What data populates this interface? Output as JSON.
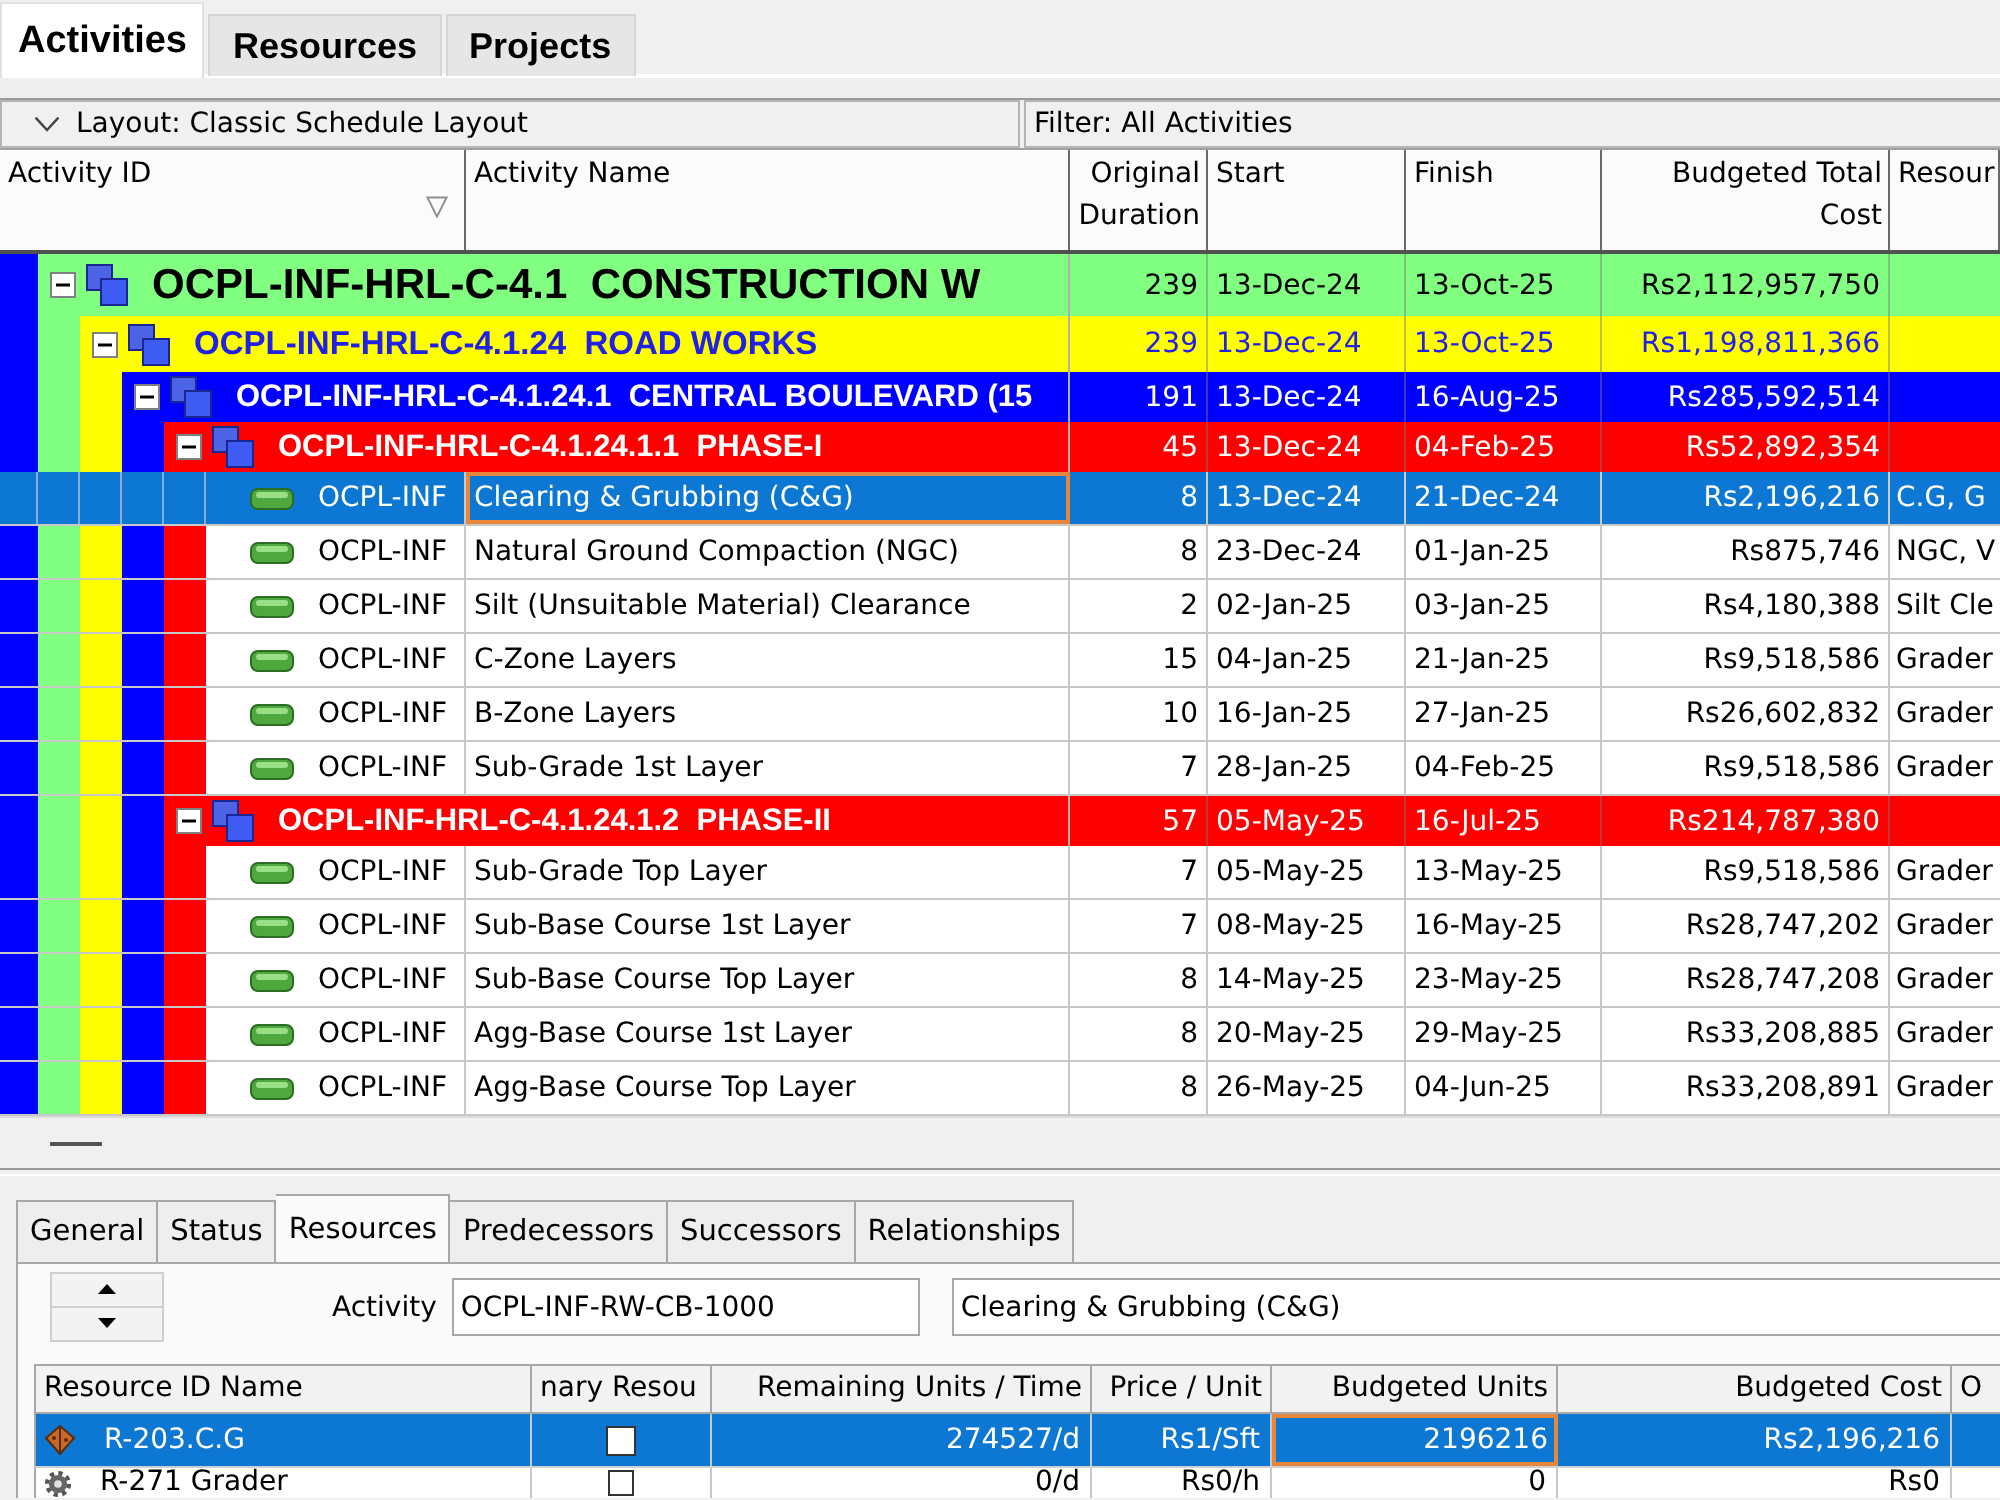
{
  "view_tabs": [
    {
      "label": "Activities",
      "selected": true
    },
    {
      "label": "Resources",
      "selected": false
    },
    {
      "label": "Projects",
      "selected": false
    }
  ],
  "layout_bar": {
    "layout": "Layout: Classic Schedule Layout",
    "filter": "Filter: All Activities"
  },
  "activities_table": {
    "columns": [
      "Activity ID",
      "Activity Name",
      "Original Duration",
      "Start",
      "Finish",
      "Budgeted Total Cost",
      "Resour"
    ],
    "rows": [
      {
        "kind": "wbs",
        "label": "OCPL-INF-HRL-C-4.1  CONSTRUCTION W",
        "expanded": true,
        "selected": false,
        "original_duration": "239",
        "start": "13-Dec-24",
        "finish": "13-Oct-25",
        "budgeted_total_cost": "Rs2,112,957,750",
        "children": [
          {
            "kind": "wbs",
            "label": "OCPL-INF-HRL-C-4.1.24  ROAD WORKS",
            "expanded": true,
            "selected": false,
            "original_duration": "239",
            "start": "13-Dec-24",
            "finish": "13-Oct-25",
            "budgeted_total_cost": "Rs1,198,811,366",
            "children": [
              {
                "kind": "wbs",
                "label": "OCPL-INF-HRL-C-4.1.24.1  CENTRAL BOULEVARD (15",
                "expanded": true,
                "selected": false,
                "original_duration": "191",
                "start": "13-Dec-24",
                "finish": "16-Aug-25",
                "budgeted_total_cost": "Rs285,592,514",
                "children": [
                  {
                    "kind": "wbs",
                    "label": "OCPL-INF-HRL-C-4.1.24.1.1  PHASE-I",
                    "expanded": true,
                    "selected": false,
                    "original_duration": "45",
                    "start": "13-Dec-24",
                    "finish": "04-Feb-25",
                    "budgeted_total_cost": "Rs52,892,354",
                    "children": [
                      {
                        "kind": "activity",
                        "activity_id": "OCPL-INF",
                        "activity_name": "Clearing & Grubbing (C&G)",
                        "original_duration": "8",
                        "start": "13-Dec-24",
                        "finish": "21-Dec-24",
                        "budgeted_total_cost": "Rs2,196,216",
                        "resources": "C.G, G",
                        "selected": true
                      },
                      {
                        "kind": "activity",
                        "activity_id": "OCPL-INF",
                        "activity_name": "Natural Ground Compaction (NGC)",
                        "original_duration": "8",
                        "start": "23-Dec-24",
                        "finish": "01-Jan-25",
                        "budgeted_total_cost": "Rs875,746",
                        "resources": "NGC, V",
                        "selected": false
                      },
                      {
                        "kind": "activity",
                        "activity_id": "OCPL-INF",
                        "activity_name": "Silt (Unsuitable Material) Clearance",
                        "original_duration": "2",
                        "start": "02-Jan-25",
                        "finish": "03-Jan-25",
                        "budgeted_total_cost": "Rs4,180,388",
                        "resources": "Silt Cle",
                        "selected": false
                      },
                      {
                        "kind": "activity",
                        "activity_id": "OCPL-INF",
                        "activity_name": "C-Zone Layers",
                        "original_duration": "15",
                        "start": "04-Jan-25",
                        "finish": "21-Jan-25",
                        "budgeted_total_cost": "Rs9,518,586",
                        "resources": "Grader",
                        "selected": false
                      },
                      {
                        "kind": "activity",
                        "activity_id": "OCPL-INF",
                        "activity_name": "B-Zone Layers",
                        "original_duration": "10",
                        "start": "16-Jan-25",
                        "finish": "27-Jan-25",
                        "budgeted_total_cost": "Rs26,602,832",
                        "resources": "Grader",
                        "selected": false
                      },
                      {
                        "kind": "activity",
                        "activity_id": "OCPL-INF",
                        "activity_name": "Sub-Grade 1st Layer",
                        "original_duration": "7",
                        "start": "28-Jan-25",
                        "finish": "04-Feb-25",
                        "budgeted_total_cost": "Rs9,518,586",
                        "resources": "Grader",
                        "selected": false
                      }
                    ]
                  },
                  {
                    "kind": "wbs",
                    "label": "OCPL-INF-HRL-C-4.1.24.1.2  PHASE-II",
                    "expanded": true,
                    "selected": false,
                    "original_duration": "57",
                    "start": "05-May-25",
                    "finish": "16-Jul-25",
                    "budgeted_total_cost": "Rs214,787,380",
                    "children": [
                      {
                        "kind": "activity",
                        "activity_id": "OCPL-INF",
                        "activity_name": "Sub-Grade Top Layer",
                        "original_duration": "7",
                        "start": "05-May-25",
                        "finish": "13-May-25",
                        "budgeted_total_cost": "Rs9,518,586",
                        "resources": "Grader",
                        "selected": false
                      },
                      {
                        "kind": "activity",
                        "activity_id": "OCPL-INF",
                        "activity_name": "Sub-Base Course 1st Layer",
                        "original_duration": "7",
                        "start": "08-May-25",
                        "finish": "16-May-25",
                        "budgeted_total_cost": "Rs28,747,202",
                        "resources": "Grader",
                        "selected": false
                      },
                      {
                        "kind": "activity",
                        "activity_id": "OCPL-INF",
                        "activity_name": "Sub-Base Course Top Layer",
                        "original_duration": "8",
                        "start": "14-May-25",
                        "finish": "23-May-25",
                        "budgeted_total_cost": "Rs28,747,208",
                        "resources": "Grader",
                        "selected": false
                      },
                      {
                        "kind": "activity",
                        "activity_id": "OCPL-INF",
                        "activity_name": "Agg-Base Course 1st Layer",
                        "original_duration": "8",
                        "start": "20-May-25",
                        "finish": "29-May-25",
                        "budgeted_total_cost": "Rs33,208,885",
                        "resources": "Grader",
                        "selected": false
                      },
                      {
                        "kind": "activity",
                        "activity_id": "OCPL-INF",
                        "activity_name": "Agg-Base Course Top Layer",
                        "original_duration": "8",
                        "start": "26-May-25",
                        "finish": "04-Jun-25",
                        "budgeted_total_cost": "Rs33,208,891",
                        "resources": "Grader",
                        "selected": false
                      }
                    ]
                  }
                ]
              }
            ]
          }
        ]
      }
    ]
  },
  "detail_panel": {
    "tabs": [
      {
        "label": "General",
        "selected": false
      },
      {
        "label": "Status",
        "selected": false
      },
      {
        "label": "Resources",
        "selected": true
      },
      {
        "label": "Predecessors",
        "selected": false
      },
      {
        "label": "Successors",
        "selected": false
      },
      {
        "label": "Relationships",
        "selected": false
      }
    ],
    "activity_label": "Activity",
    "activity_id": "OCPL-INF-RW-CB-1000",
    "activity_name": "Clearing & Grubbing (C&G)",
    "resources_table": {
      "columns": [
        "Resource ID Name",
        "nary Resou",
        "Remaining Units / Time",
        "Price / Unit",
        "Budgeted Units",
        "Budgeted Cost",
        "O"
      ],
      "rows": [
        {
          "kind": "material",
          "resource": "R-203.C.G",
          "checked": false,
          "remaining_units_time": "274527/d",
          "price_unit": "Rs1/Sft",
          "budgeted_units": "2196216",
          "budgeted_cost": "Rs2,196,216",
          "selected": true
        },
        {
          "kind": "equipment",
          "resource": "R-271 Grader",
          "checked": false,
          "remaining_units_time": "0/d",
          "price_unit": "Rs0/h",
          "budgeted_units": "0",
          "budgeted_cost": "Rs0",
          "selected": false
        }
      ]
    }
  }
}
